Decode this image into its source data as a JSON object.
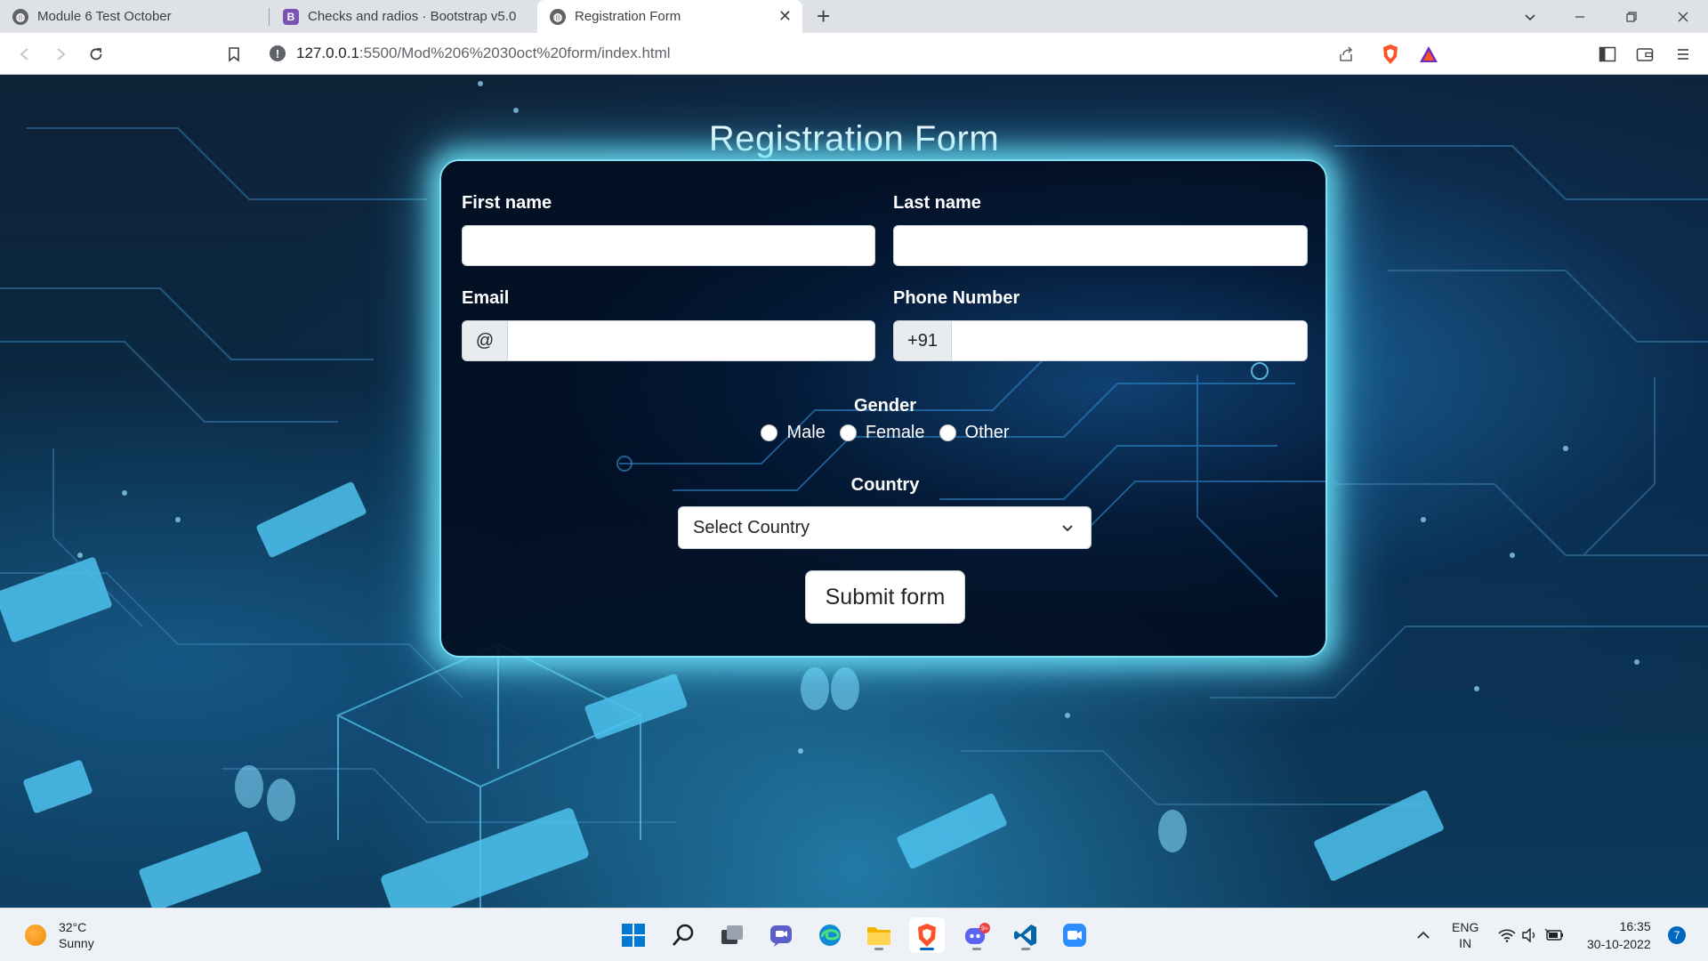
{
  "browser": {
    "tabs": [
      {
        "title": "Module 6 Test October",
        "icon": "globe-icon"
      },
      {
        "title": "Checks and radios · Bootstrap v5.0",
        "icon": "bootstrap-icon",
        "icon_letter": "B"
      },
      {
        "title": "Registration Form",
        "icon": "globe-icon",
        "active": true
      }
    ],
    "new_tab_symbol": "+",
    "url_host": "127.0.0.1",
    "url_rest": ":5500/Mod%206%2030oct%20form/index.html"
  },
  "form": {
    "title": "Registration Form",
    "first_name_label": "First name",
    "last_name_label": "Last name",
    "email_label": "Email",
    "email_addon": "@",
    "phone_label": "Phone Number",
    "phone_addon": "+91",
    "gender_label": "Gender",
    "gender_options": [
      "Male",
      "Female",
      "Other"
    ],
    "country_label": "Country",
    "country_selected": "Select Country",
    "submit_label": "Submit form"
  },
  "taskbar": {
    "weather_temp": "32°C",
    "weather_desc": "Sunny",
    "lang_top": "ENG",
    "lang_bottom": "IN",
    "time": "16:35",
    "date": "30-10-2022",
    "notification_count": "7",
    "discord_badge": "9+"
  },
  "colors": {
    "accent_glow": "#7fe3f5",
    "card_bg": "#020e22",
    "brave": "#fb542b",
    "vscode": "#0065a9",
    "windows_blue": "#0078d4"
  }
}
